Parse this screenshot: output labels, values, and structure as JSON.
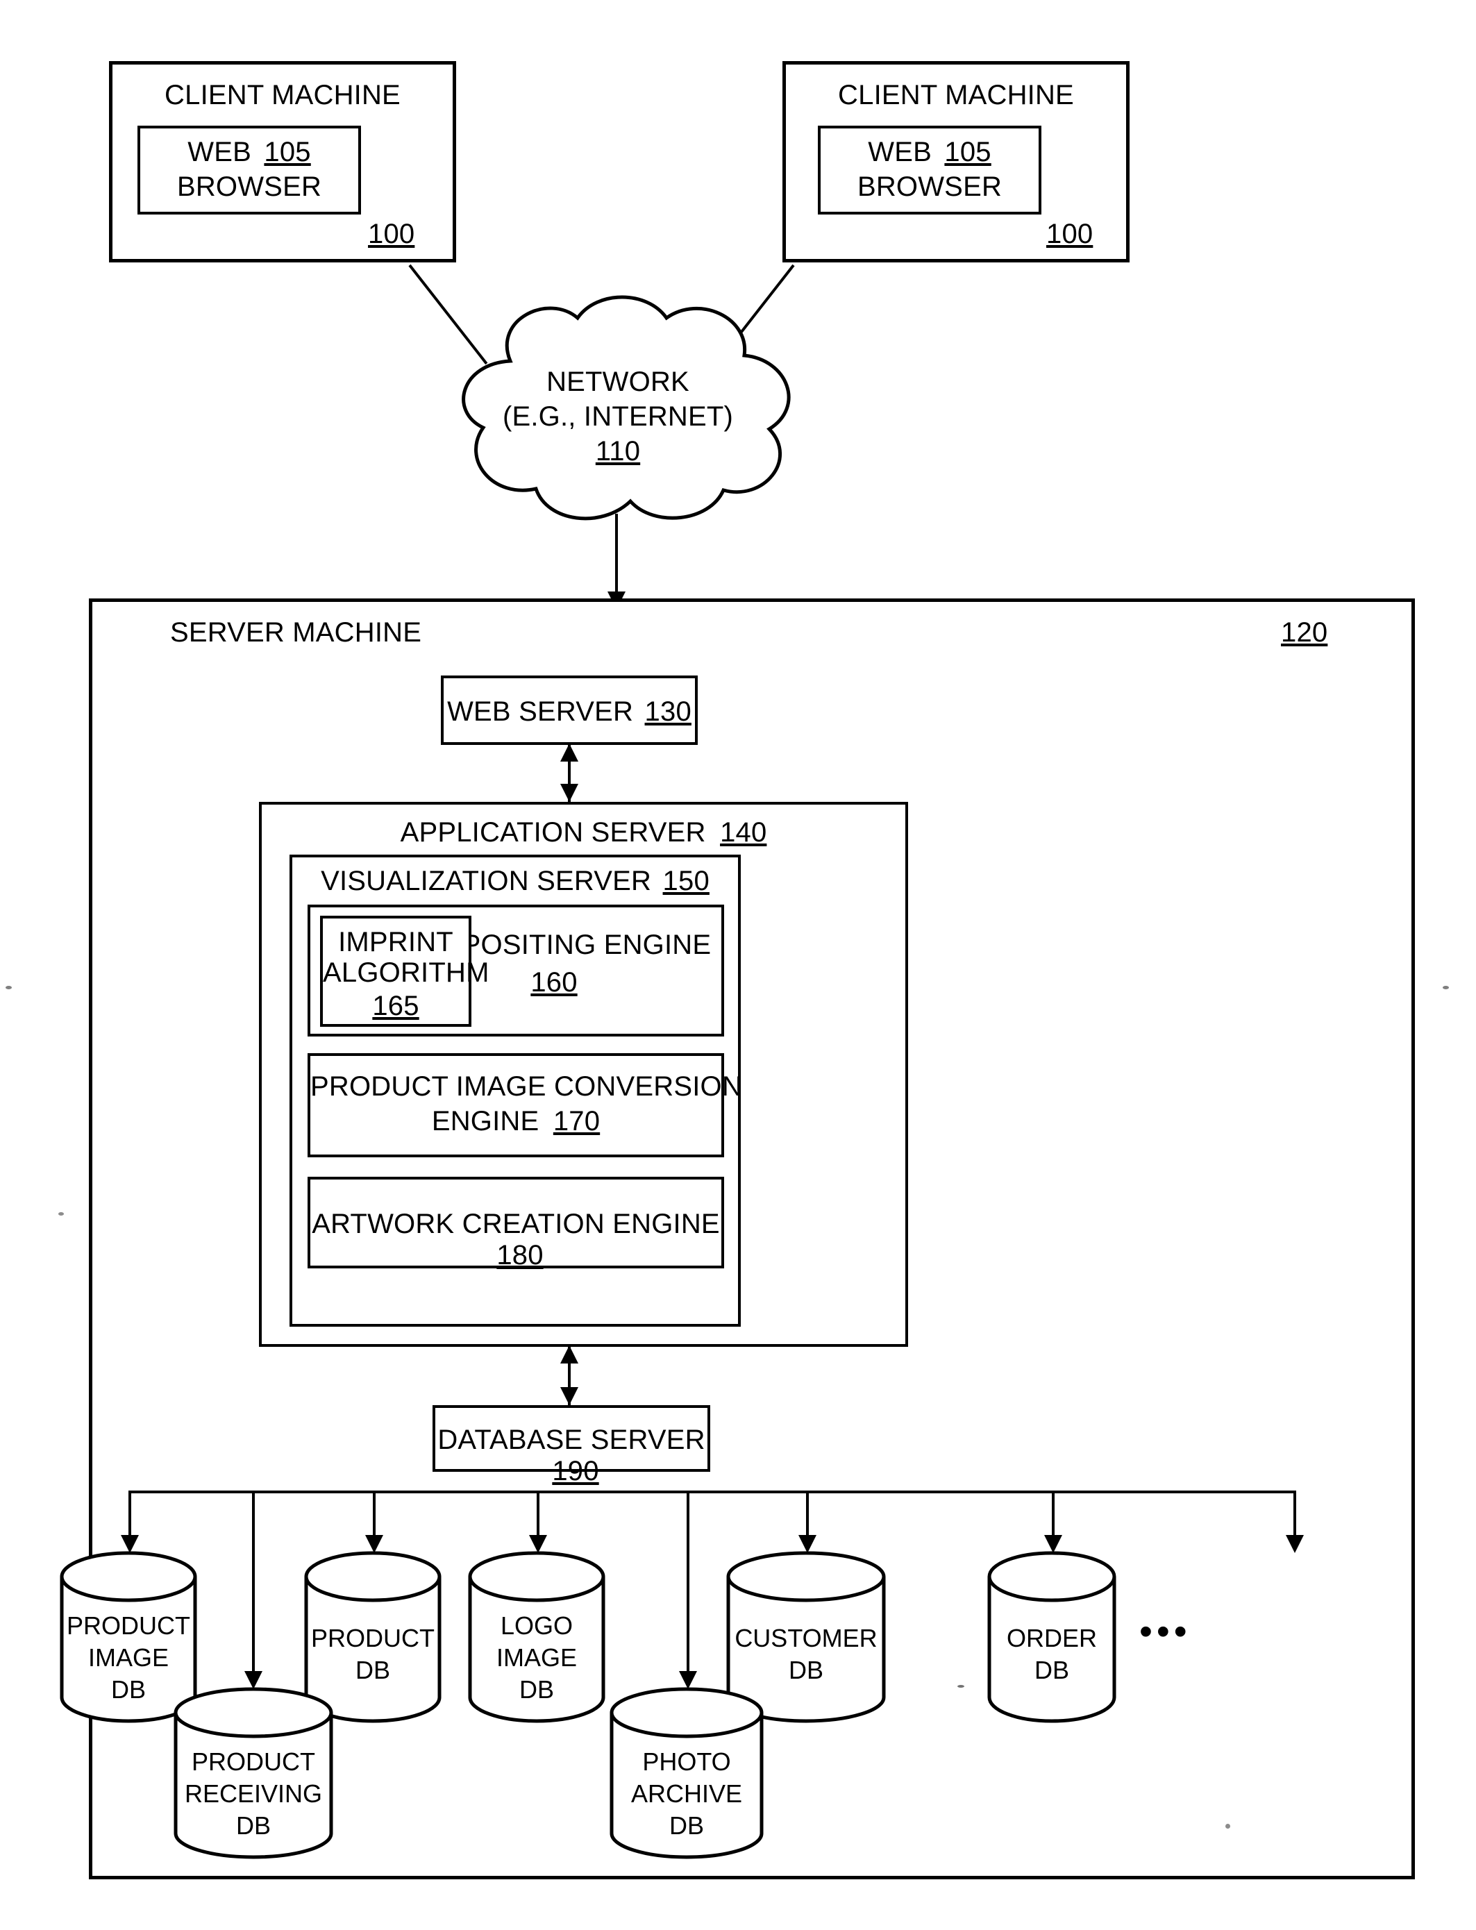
{
  "figure": {
    "clients": [
      {
        "title": "CLIENT MACHINE",
        "ref": "100",
        "browser": {
          "line1": "WEB",
          "line2": "BROWSER",
          "ref": "105"
        }
      },
      {
        "title": "CLIENT MACHINE",
        "ref": "100",
        "browser": {
          "line1": "WEB",
          "line2": "BROWSER",
          "ref": "105"
        }
      }
    ],
    "network": {
      "line1": "NETWORK",
      "line2": "(E.G., INTERNET)",
      "ref": "110"
    },
    "server_machine": {
      "title": "SERVER MACHINE",
      "ref": "120",
      "web_server": {
        "label": "WEB SERVER",
        "ref": "130"
      },
      "application_server": {
        "label": "APPLICATION SERVER",
        "ref": "140",
        "visualization_server": {
          "label": "VISUALIZATION SERVER",
          "ref": "150",
          "compositing_engine": {
            "label": "COMPOSITING ENGINE",
            "ref": "160",
            "imprint_algorithm": {
              "line1": "IMPRINT",
              "line2": "ALGORITHM",
              "ref": "165"
            }
          },
          "product_image_conversion_engine": {
            "line1": "PRODUCT IMAGE CONVERSION",
            "line2": "ENGINE",
            "ref": "170"
          },
          "artwork_creation_engine": {
            "label": "ARTWORK CREATION ENGINE",
            "ref": "180"
          }
        }
      },
      "database_server": {
        "label": "DATABASE SERVER",
        "ref": "190"
      },
      "databases_top": [
        {
          "lines": [
            "PRODUCT",
            "IMAGE",
            "DB"
          ]
        },
        {
          "lines": [
            "PRODUCT",
            "DB"
          ]
        },
        {
          "lines": [
            "LOGO",
            "IMAGE",
            "DB"
          ]
        },
        {
          "lines": [
            "CUSTOMER",
            "DB"
          ]
        },
        {
          "lines": [
            "ORDER",
            "DB"
          ]
        }
      ],
      "databases_bottom": [
        {
          "lines": [
            "PRODUCT",
            "RECEIVING",
            "DB"
          ]
        },
        {
          "lines": [
            "PHOTO",
            "ARCHIVE",
            "DB"
          ]
        }
      ],
      "more_indicator": "•••"
    },
    "colors": {
      "ink": "#000000",
      "paper": "#ffffff"
    }
  }
}
